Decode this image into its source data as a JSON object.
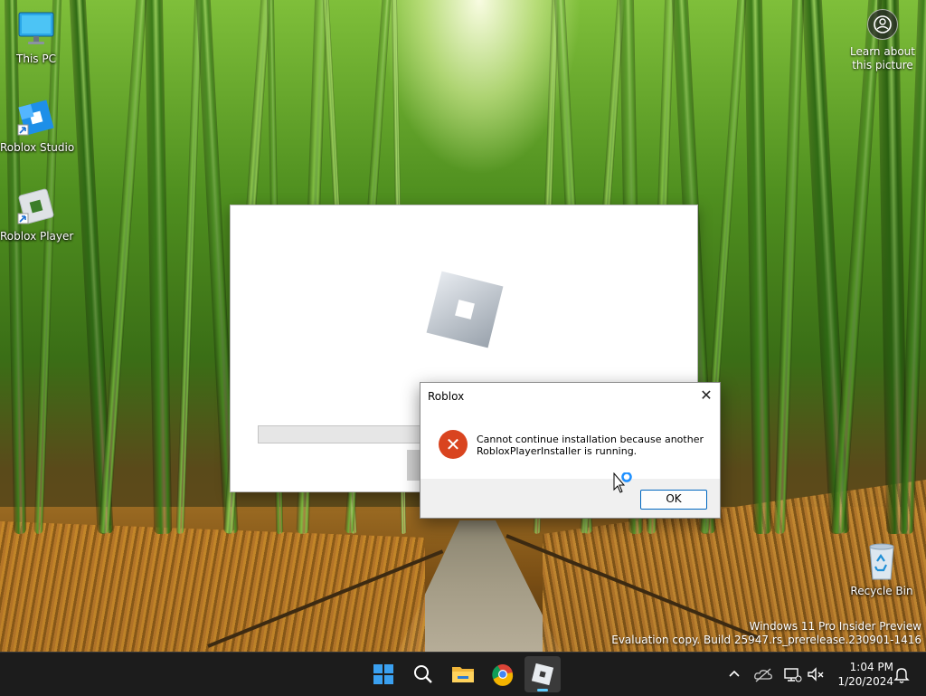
{
  "desktop_icons": [
    {
      "label": "This PC",
      "icon": "monitor-icon"
    },
    {
      "label": "Roblox Studio",
      "icon": "roblox-studio-icon"
    },
    {
      "label": "Roblox Player",
      "icon": "roblox-player-icon"
    },
    {
      "label": "Recycle Bin",
      "icon": "recycle-bin-icon"
    }
  ],
  "learn_about_picture": {
    "line1": "Learn about",
    "line2": "this picture"
  },
  "dialog": {
    "title": "Roblox",
    "close_glyph": "✕",
    "error_glyph": "✕",
    "message": "Cannot continue installation because another RobloxPlayerInstaller is running.",
    "ok_label": "OK"
  },
  "watermark": {
    "line1": "Windows 11 Pro Insider Preview",
    "line2": "Evaluation copy. Build 25947.rs_prerelease.230901-1416"
  },
  "taskbar": {
    "apps": [
      "start-icon",
      "search-icon",
      "file-explorer-icon",
      "chrome-icon",
      "roblox-icon"
    ],
    "active_app": "roblox-icon",
    "tray": [
      "chevron-up-icon",
      "onedrive-icon",
      "network-icon",
      "speaker-muted-icon",
      "notification-bell-icon"
    ],
    "time": "1:04 PM",
    "date": "1/20/2024"
  },
  "colors": {
    "error_red": "#d9441f",
    "accent_blue": "#0067c0",
    "taskbar_bg": "#1c1c1c",
    "active_indicator": "#60cdff"
  }
}
